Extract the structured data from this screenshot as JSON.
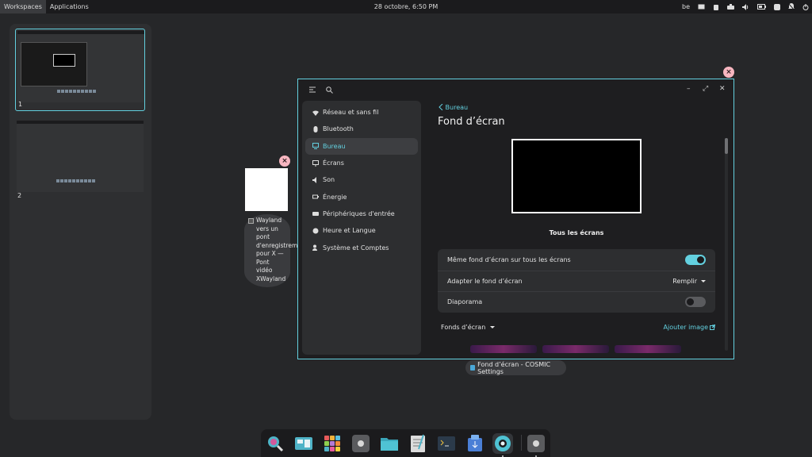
{
  "topbar": {
    "workspaces_label": "Workspaces",
    "applications_label": "Applications",
    "clock": "28 octobre, 6:50 PM",
    "keyboard_layout": "be"
  },
  "workspaces": [
    {
      "number": "1",
      "active": true
    },
    {
      "number": "2",
      "active": false
    }
  ],
  "xwayland_window": {
    "label": "Wayland vers un pont d'enregistrement pour X — Pont vidéo XWayland"
  },
  "settings": {
    "sidebar": [
      {
        "label": "Réseau et sans fil",
        "icon": "wifi-icon"
      },
      {
        "label": "Bluetooth",
        "icon": "bluetooth-icon"
      },
      {
        "label": "Bureau",
        "icon": "monitor-icon",
        "active": true
      },
      {
        "label": "Écrans",
        "icon": "display-icon"
      },
      {
        "label": "Son",
        "icon": "speaker-icon"
      },
      {
        "label": "Énergie",
        "icon": "battery-icon"
      },
      {
        "label": "Périphériques d'entrée",
        "icon": "keyboard-icon"
      },
      {
        "label": "Heure et Langue",
        "icon": "clock-globe-icon"
      },
      {
        "label": "Système et Comptes",
        "icon": "users-icon"
      }
    ],
    "breadcrumb": "Bureau",
    "page_title": "Fond d’écran",
    "preview_label": "Tous les écrans",
    "rows": {
      "same_wallpaper": {
        "label": "Même fond d’écran sur tous les écrans",
        "enabled": true
      },
      "adapt": {
        "label": "Adapter le fond d’écran",
        "value": "Remplir"
      },
      "slideshow": {
        "label": "Diaporama",
        "enabled": false
      }
    },
    "wallpapers_dropdown": "Fonds d’écran",
    "add_image": "Ajouter image"
  },
  "window_caption": "Fond d’écran - COSMIC Settings",
  "colors": {
    "accent": "#63d0df",
    "close": "#f7b6c0",
    "panel": "#1b1b1d",
    "background": "#262729"
  },
  "dock": [
    {
      "name": "search-app-icon"
    },
    {
      "name": "workspace-overview-icon"
    },
    {
      "name": "app-library-icon"
    },
    {
      "name": "settings-app-icon"
    },
    {
      "name": "files-app-icon"
    },
    {
      "name": "text-editor-icon"
    },
    {
      "name": "terminal-icon"
    },
    {
      "name": "store-icon"
    },
    {
      "name": "cosmic-settings-active-icon"
    },
    {
      "name": "settings-secondary-icon"
    }
  ]
}
